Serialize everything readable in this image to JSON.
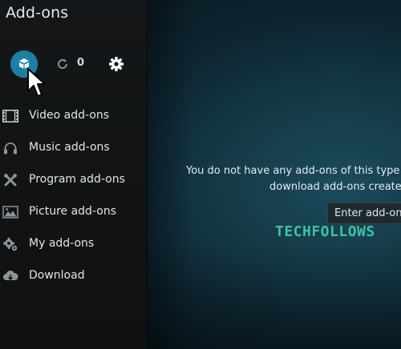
{
  "window": {
    "title": "Add-ons"
  },
  "toolbar": {
    "install_icon": "open-box-icon",
    "update_icon": "refresh-icon",
    "update_count": "0",
    "settings_icon": "gear-icon",
    "accent_color": "#1c7fa3"
  },
  "sidebar": {
    "items": [
      {
        "label": "Video add-ons",
        "icon": "film-strip-icon"
      },
      {
        "label": "Music add-ons",
        "icon": "headphones-icon"
      },
      {
        "label": "Program add-ons",
        "icon": "tools-icon"
      },
      {
        "label": "Picture add-ons",
        "icon": "picture-icon"
      },
      {
        "label": "My add-ons",
        "icon": "gears-icon"
      },
      {
        "label": "Download",
        "icon": "cloud-download-icon"
      }
    ]
  },
  "main": {
    "message_line1": "You do not have any add-ons of this type in",
    "message_line2": "download add-ons created",
    "tooltip": "Enter add-on b"
  },
  "watermark": "TECHFOLLOWS",
  "colors": {
    "sidebar_bg": "#121415",
    "content_bg": "#153a48",
    "watermark": "#3fc1a0"
  }
}
